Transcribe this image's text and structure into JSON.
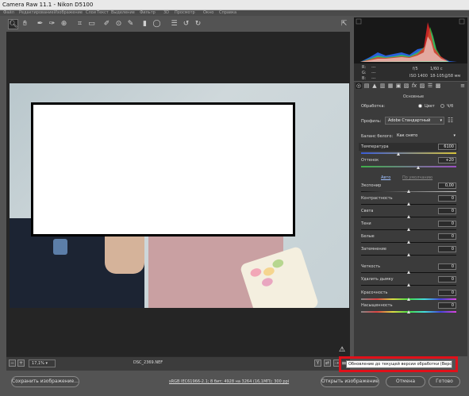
{
  "window": {
    "title": "Camera Raw 11.1  -  Nikon D5100"
  },
  "menubar": {
    "items": [
      "Файл",
      "Редактирование",
      "Изображение",
      "Слои",
      "Текст",
      "Выделение",
      "Фильтр",
      "3D",
      "Просмотр",
      "Окно",
      "Справка"
    ]
  },
  "toolbar": {
    "tools": [
      "zoom-icon",
      "hand-icon",
      "white-balance-icon",
      "color-sampler-icon",
      "targeted-adjustment-icon",
      "crop-icon",
      "straighten-icon",
      "spot-removal-icon",
      "red-eye-icon",
      "adjustment-brush-icon",
      "graduated-filter-icon",
      "radial-filter-icon",
      "preferences-icon",
      "rotate-ccw-icon",
      "rotate-cw-icon"
    ],
    "fullscreen": "fullscreen-icon"
  },
  "histogram_meta": {
    "r_label": "R:",
    "g_label": "G:",
    "b_label": "B:",
    "r_value": "---",
    "g_value": "---",
    "b_value": "---",
    "aperture": "f/5",
    "shutter": "1/60 с",
    "iso": "ISO 1400",
    "lens": "18-105@58 мм"
  },
  "panel": {
    "section_title": "Основные",
    "treatment_label": "Обработка:",
    "color_option": "Цвет",
    "bw_option": "Ч/б",
    "profile_label": "Профиль:",
    "profile_value": "Adobe Стандартный",
    "wb_label": "Баланс белого:",
    "wb_value": "Как снято",
    "temperature_label": "Температура",
    "temperature_value": "6100",
    "tint_label": "Оттенок",
    "tint_value": "+20",
    "auto_link": "Авто",
    "default_link": "По умолчанию",
    "sliders": [
      {
        "label": "Экспонир",
        "value": "0,00"
      },
      {
        "label": "Контрастность",
        "value": "0"
      },
      {
        "label": "Света",
        "value": "0"
      },
      {
        "label": "Тени",
        "value": "0"
      },
      {
        "label": "Белые",
        "value": "0"
      },
      {
        "label": "Затемнение",
        "value": "0"
      },
      {
        "label": "Четкость",
        "value": "0"
      },
      {
        "label": "Удалить дымку",
        "value": "0"
      },
      {
        "label": "Красочность",
        "value": "0"
      },
      {
        "label": "Насыщенность",
        "value": "0"
      }
    ]
  },
  "bottombar": {
    "zoom": "17,1%",
    "filename": "DSC_2369.NEF"
  },
  "tooltip": "Обновление до текущей версии обработки (Версия 5)",
  "footer": {
    "save_button": "Сохранить изображение...",
    "workflow_link": "sRGB IEC61966-2.1; 8 бит; 4928 на 3264 (16,1МП); 300 ppi",
    "open_button": "Открыть изображение",
    "cancel_button": "Отмена",
    "done_button": "Готово"
  },
  "colors": {
    "highlight": "#e0101a",
    "temperature_track": "#d6c23a",
    "tint_track": "#9b4fc4"
  }
}
